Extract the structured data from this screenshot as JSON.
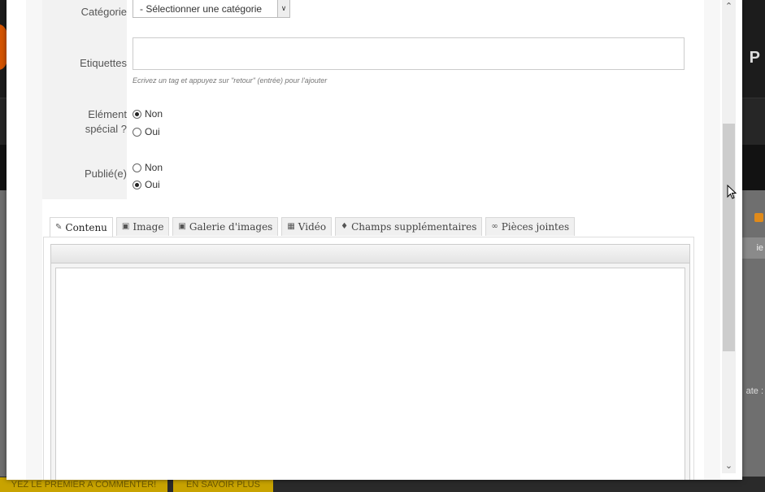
{
  "form": {
    "category": {
      "label": "Catégorie",
      "selected": "- Sélectionner une catégorie"
    },
    "tags": {
      "label": "Etiquettes",
      "value": "",
      "hint": "Ecrivez un tag et appuyez sur \"retour\" (entrée) pour l'ajouter"
    },
    "featured": {
      "label_line1": "Elément",
      "label_line2": "spécial ?",
      "options": [
        {
          "label": "Non",
          "checked": true
        },
        {
          "label": "Oui",
          "checked": false
        }
      ]
    },
    "published": {
      "label": "Publié(e)",
      "options": [
        {
          "label": "Non",
          "checked": false
        },
        {
          "label": "Oui",
          "checked": true
        }
      ]
    }
  },
  "tabs": [
    {
      "label": "Contenu",
      "icon": "edit-icon",
      "active": true
    },
    {
      "label": "Image",
      "icon": "image-icon",
      "active": false
    },
    {
      "label": "Galerie d'images",
      "icon": "camera-icon",
      "active": false
    },
    {
      "label": "Vidéo",
      "icon": "film-icon",
      "active": false
    },
    {
      "label": "Champs supplémentaires",
      "icon": "puzzle-icon",
      "active": false
    },
    {
      "label": "Pièces jointes",
      "icon": "paperclip-icon",
      "active": false
    }
  ],
  "background": {
    "sidebar_text": "ie",
    "date_text": "ate :",
    "button_comment": "YEZ LE PREMIER A COMMENTER!",
    "button_more": "EN SAVOIR PLUS"
  }
}
